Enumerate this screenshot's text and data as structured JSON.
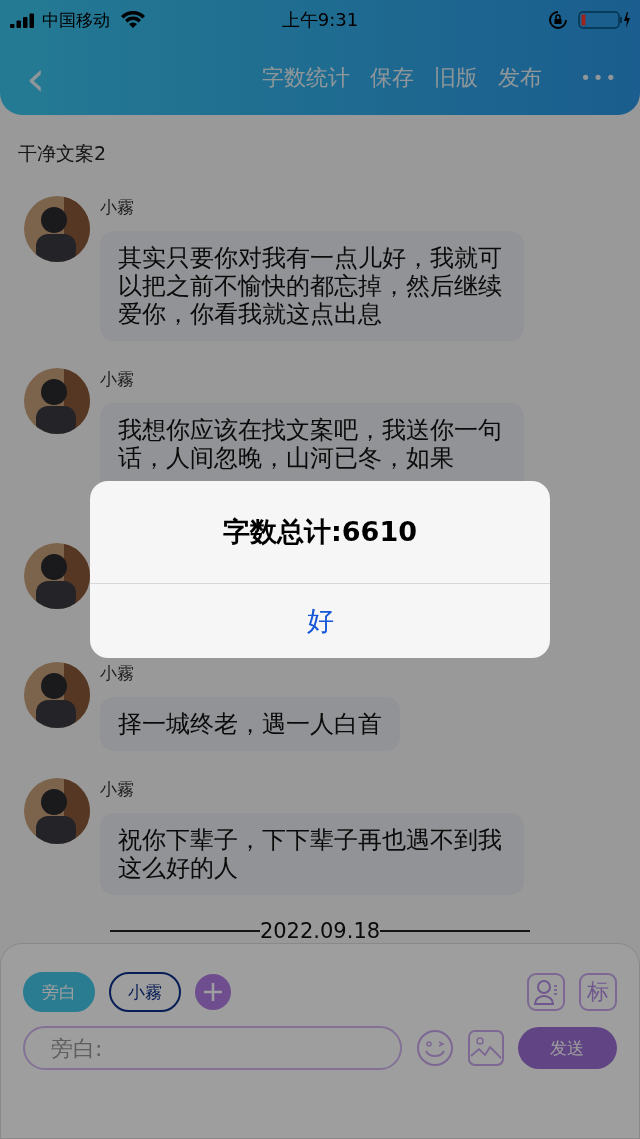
{
  "status_bar": {
    "carrier": "中国移动",
    "time": "上午9:31"
  },
  "nav": {
    "back": "‹",
    "actions": [
      "字数统计",
      "保存",
      "旧版",
      "发布"
    ],
    "more": "•••"
  },
  "doc_title": "干净文案2",
  "messages": [
    {
      "kind": "text",
      "name": "小霧",
      "text": "其实只要你对我有一点儿好，我就可以把之前不愉快的都忘掉，然后继续爱你，你看我就这点出息",
      "cut": false
    },
    {
      "kind": "text",
      "name": "小霧",
      "text": "我想你应该在找文案吧，我送你一句话，人间忽晚，山河已冬，如果",
      "cut": true
    },
    {
      "kind": "covered"
    },
    {
      "kind": "text",
      "name": "小霧",
      "text": "择一城终老，遇一人白首",
      "cut": false
    },
    {
      "kind": "text",
      "name": "小霧",
      "text": "祝你下辈子，下下辈子再也遇不到我这么好的人",
      "cut": false
    }
  ],
  "date_divider": "2022.09.18",
  "composer": {
    "roles": [
      {
        "label": "旁白",
        "selected": true
      },
      {
        "label": "小霧",
        "selected": false
      }
    ],
    "mark_button": "标",
    "placeholder": "旁白:",
    "send": "发送"
  },
  "alert": {
    "message": "字数总计:6610",
    "button": "好"
  }
}
